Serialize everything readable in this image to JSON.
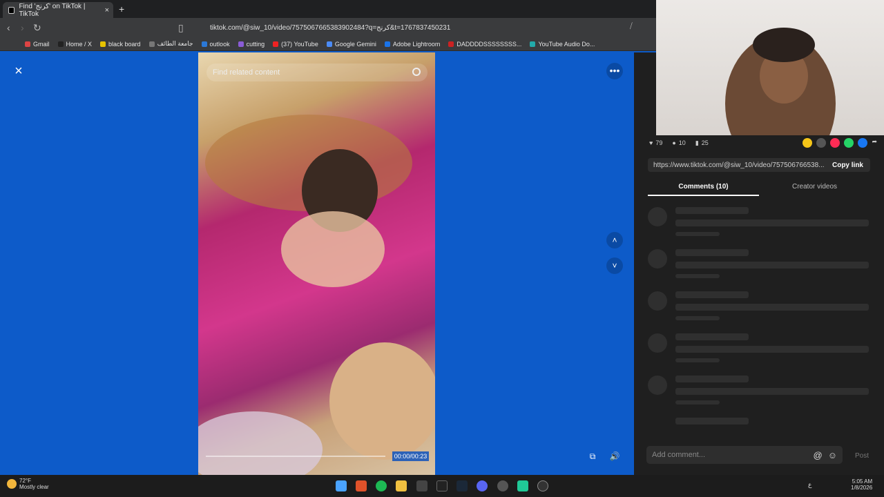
{
  "browser": {
    "tab_title": "Find 'كرنج' on TikTok | TikTok",
    "tab_close": "×",
    "new_tab": "+",
    "url": "tiktok.com/@siw_10/video/7575067665383902484?q=كرنج&t=1767837450231",
    "bookmarks": [
      "Gmail",
      "Home / X",
      "black board",
      "جامعة الطائف",
      "outlook",
      "cutting",
      "(37) YouTube",
      "Google Gemini",
      "Adobe Lightroom",
      "DADDDDSSSSSSSS...",
      "YouTube Audio Do..."
    ],
    "bookmark_colors": [
      "#d44",
      "#222",
      "#e6c200",
      "#777",
      "#2b78d6",
      "#8a5cd6",
      "#e22",
      "#4b8bf5",
      "#1a73e8",
      "#c22",
      "#2aa"
    ]
  },
  "player": {
    "search_placeholder": "Find related content",
    "close_icon": "×",
    "more_icon": "•••",
    "up_icon": "˄",
    "down_icon": "˅",
    "time": "00:00/00:23",
    "progress": 0.0
  },
  "panel": {
    "likes": "79",
    "comments": "10",
    "saves": "25",
    "share_colors": [
      "#f5c518",
      "#555",
      "#fe2c55",
      "#25d366",
      "#1877f2"
    ],
    "link": "https://www.tiktok.com/@siw_10/video/757506766538...",
    "copy_link": "Copy link",
    "tab_comments": "Comments (10)",
    "tab_creator": "Creator videos",
    "comment_placeholder": "Add comment...",
    "post": "Post"
  },
  "taskbar": {
    "temp": "72°F",
    "weather": "Mostly clear",
    "time": "5:05 AM",
    "date": "1/8/2026",
    "lang": "ع"
  }
}
